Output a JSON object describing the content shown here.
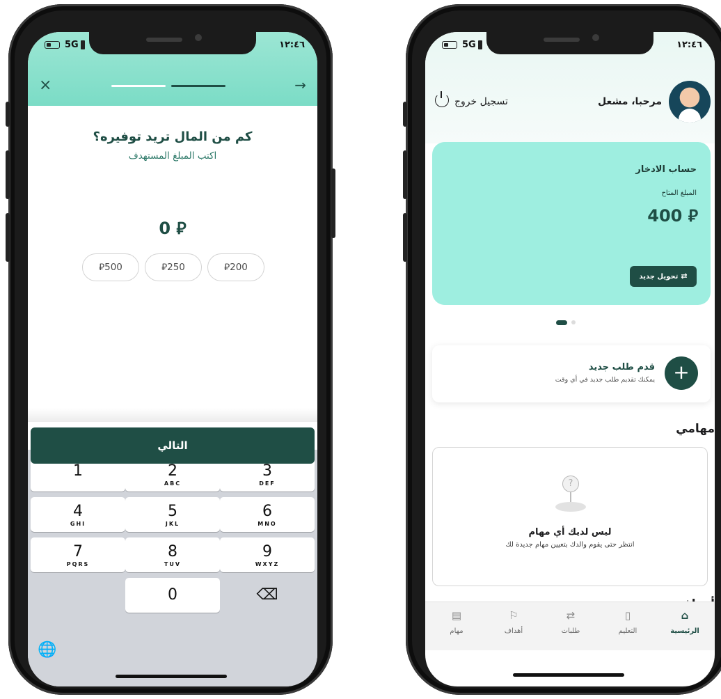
{
  "left_screen": {
    "status": {
      "network": "5G",
      "time": "١٢:٤٦"
    },
    "header": {
      "close_icon": "×",
      "back_icon": "→"
    },
    "question": "كم من المال تريد توفيره؟",
    "subtitle": "اكتب المبلغ المستهدف",
    "amount": "0 ⃁",
    "quick_amounts": [
      "⃁500",
      "⃁250",
      "⃁200"
    ],
    "next_label": "التالي",
    "keypad": {
      "keys": [
        {
          "digit": "1",
          "letters": ""
        },
        {
          "digit": "2",
          "letters": "ABC"
        },
        {
          "digit": "3",
          "letters": "DEF"
        },
        {
          "digit": "4",
          "letters": "GHI"
        },
        {
          "digit": "5",
          "letters": "JKL"
        },
        {
          "digit": "6",
          "letters": "MNO"
        },
        {
          "digit": "7",
          "letters": "PQRS"
        },
        {
          "digit": "8",
          "letters": "TUV"
        },
        {
          "digit": "9",
          "letters": "WXYZ"
        },
        {
          "digit": "0",
          "letters": ""
        }
      ],
      "delete_icon": "⌫",
      "globe_icon": "🌐"
    }
  },
  "right_screen": {
    "status": {
      "network": "5G",
      "time": "١٢:٤٦"
    },
    "greeting": "مرحبا، مشعل",
    "logout_label": "تسجيل خروج",
    "savings_card": {
      "title": "حساب الادخار",
      "available_label": "المبلغ المتاح",
      "amount": "400 ⃁",
      "transfer_label": "تحويل جديد",
      "transfer_icon": "⇄"
    },
    "new_request": {
      "title": "قدم طلب جديد",
      "subtitle": "يمكنك تقديم طلب جديد في أي وقت",
      "plus_icon": "+"
    },
    "tasks": {
      "heading": "مهامي",
      "empty_title": "ليس لديك أي مهام",
      "empty_subtitle": "انتظر حتى يقوم والدك بتعيين مهام جديدة لك",
      "empty_icon": "?"
    },
    "goals_heading": "أهدافي",
    "tabs": [
      {
        "label": "الرئيسية",
        "icon": "⌂"
      },
      {
        "label": "التعليم",
        "icon": "▯"
      },
      {
        "label": "طلبات",
        "icon": "⇄"
      },
      {
        "label": "أهداف",
        "icon": "⚐"
      },
      {
        "label": "مهام",
        "icon": "▤"
      }
    ]
  },
  "colors": {
    "primary": "#1f4e45",
    "mint": "#9eeee0",
    "header_gradient": "#7bdcc6"
  }
}
